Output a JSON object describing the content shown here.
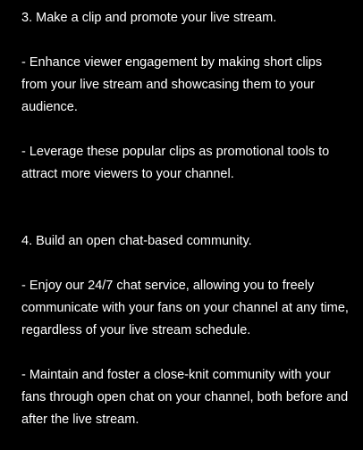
{
  "sections": [
    {
      "heading": "3. Make a clip and promote your live stream.",
      "points": [
        "- Enhance viewer engagement by making short clips from your live stream and showcasing them to your audience.",
        "- Leverage these popular clips as promotional tools to attract more viewers to your channel."
      ]
    },
    {
      "heading": "4. Build an open chat-based community.",
      "points": [
        "- Enjoy our 24/7 chat service, allowing you to freely communicate with your fans on your channel at any time, regardless of your live stream schedule.",
        "- Maintain and foster a close-knit community with your fans through open chat on your channel, both before and after the live stream."
      ]
    }
  ],
  "colors": {
    "background": "#000000",
    "text": "#ffffff"
  }
}
